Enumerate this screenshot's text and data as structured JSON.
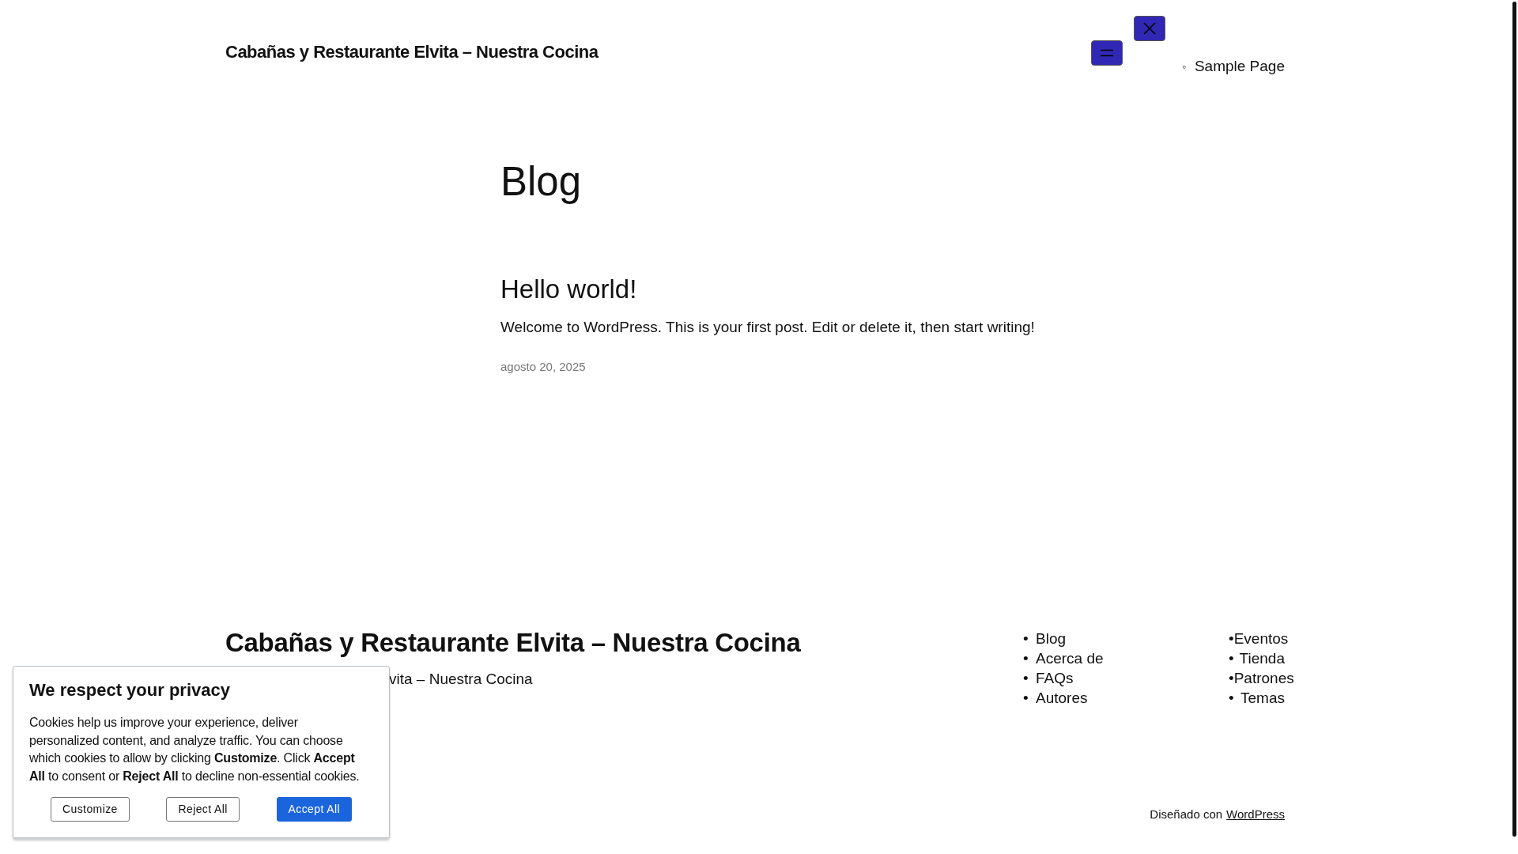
{
  "header": {
    "site_title": "Cabañas y Restaurante Elvita – Nuestra Cocina",
    "nav_items": [
      {
        "label": "Sample Page",
        "marker": "◦"
      }
    ]
  },
  "main": {
    "page_title": "Blog",
    "posts": [
      {
        "title": "Hello world!",
        "excerpt": "Welcome to WordPress. This is your first post. Edit or delete it, then start writing!",
        "date": "agosto 20, 2025"
      }
    ]
  },
  "footer": {
    "site_title": "Cabañas y Restaurante Elvita – Nuestra Cocina",
    "tagline": "vita – Nuestra Cocina",
    "nav_columns": [
      [
        {
          "label": "Blog",
          "marker": "•"
        },
        {
          "label": "Acerca de",
          "marker": "•"
        },
        {
          "label": "FAQs",
          "marker": "•"
        },
        {
          "label": "Autores",
          "marker": "•"
        }
      ],
      [
        {
          "label": "Eventos",
          "marker": "•"
        },
        {
          "label": "Tienda",
          "marker": "•"
        },
        {
          "label": "Patrones",
          "marker": "•"
        },
        {
          "label": "Temas",
          "marker": "•"
        }
      ]
    ],
    "credit": "Diseñado con",
    "credit_link": "WordPress"
  },
  "cookie_banner": {
    "title": "We respect your privacy",
    "text": "Cookies help us improve your experience, deliver personalized content, and analyze traffic. You can choose which cookies to allow by clicking **Customize**. Click **Accept All** to consent or **Reject All** to decline non-essential cookies.",
    "buttons": [
      {
        "label": "Customize",
        "kind": "secondary"
      },
      {
        "label": "Reject All",
        "kind": "secondary"
      },
      {
        "label": "Accept All",
        "kind": "primary"
      }
    ]
  }
}
